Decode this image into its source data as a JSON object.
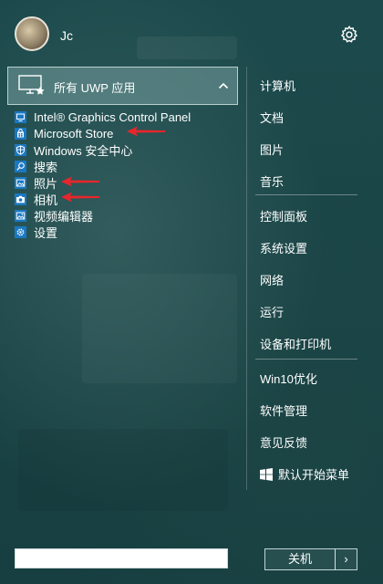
{
  "user": {
    "name": "Jc"
  },
  "uwp": {
    "label": "所有 UWP 应用"
  },
  "apps": [
    {
      "label": "Intel® Graphics Control Panel",
      "icon": "intel-graphics-icon",
      "color": "#1a78c2"
    },
    {
      "label": "Microsoft Store",
      "icon": "store-icon",
      "color": "#1a78c2"
    },
    {
      "label": "Windows 安全中心",
      "icon": "shield-icon",
      "color": "#1a78c2"
    },
    {
      "label": "搜索",
      "icon": "search-icon",
      "color": "#1a78c2"
    },
    {
      "label": "照片",
      "icon": "photos-icon",
      "color": "#1a78c2"
    },
    {
      "label": "相机",
      "icon": "camera-icon",
      "color": "#1a78c2"
    },
    {
      "label": "视频编辑器",
      "icon": "video-editor-icon",
      "color": "#1a78c2"
    },
    {
      "label": "设置",
      "icon": "settings-icon",
      "color": "#1a78c2"
    }
  ],
  "annotations": {
    "arrow_color": "#e8262b"
  },
  "right_panel": {
    "group1": [
      "计算机",
      "文档",
      "图片",
      "音乐"
    ],
    "group2": [
      "控制面板",
      "系统设置",
      "网络",
      "运行",
      "设备和打印机"
    ],
    "group3": [
      "Win10优化",
      "软件管理",
      "意见反馈",
      "默认开始菜单"
    ]
  },
  "search": {
    "value": ""
  },
  "power": {
    "label": "关机",
    "more": "›"
  }
}
